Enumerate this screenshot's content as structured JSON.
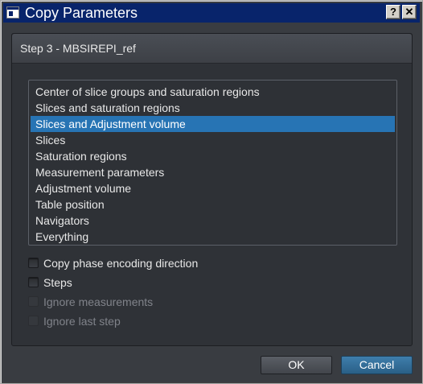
{
  "window": {
    "title": "Copy Parameters",
    "help_label": "?",
    "close_label": "✕"
  },
  "panel": {
    "title": "Step 3 - MBSIREPI_ref"
  },
  "list": {
    "items": [
      "Center of slice groups and saturation regions",
      "Slices and saturation regions",
      "Slices and Adjustment volume",
      "Slices",
      "Saturation regions",
      "Measurement parameters",
      "Adjustment volume",
      "Table position",
      "Navigators",
      "Everything"
    ],
    "selected_item": "Slices and Adjustment volume"
  },
  "options": {
    "copy_phase_encoding": {
      "label": "Copy phase encoding direction",
      "checked": false,
      "enabled": true
    },
    "steps": {
      "label": "Steps",
      "checked": false,
      "enabled": true
    },
    "ignore_measurements": {
      "label": "Ignore measurements",
      "checked": false,
      "enabled": false
    },
    "ignore_last_step": {
      "label": "Ignore last step",
      "checked": false,
      "enabled": false
    }
  },
  "buttons": {
    "ok_label": "OK",
    "cancel_label": "Cancel"
  },
  "colors": {
    "titlebar": "#08246b",
    "selection": "#2774b4",
    "cancel_accent": "#2a5f86"
  }
}
